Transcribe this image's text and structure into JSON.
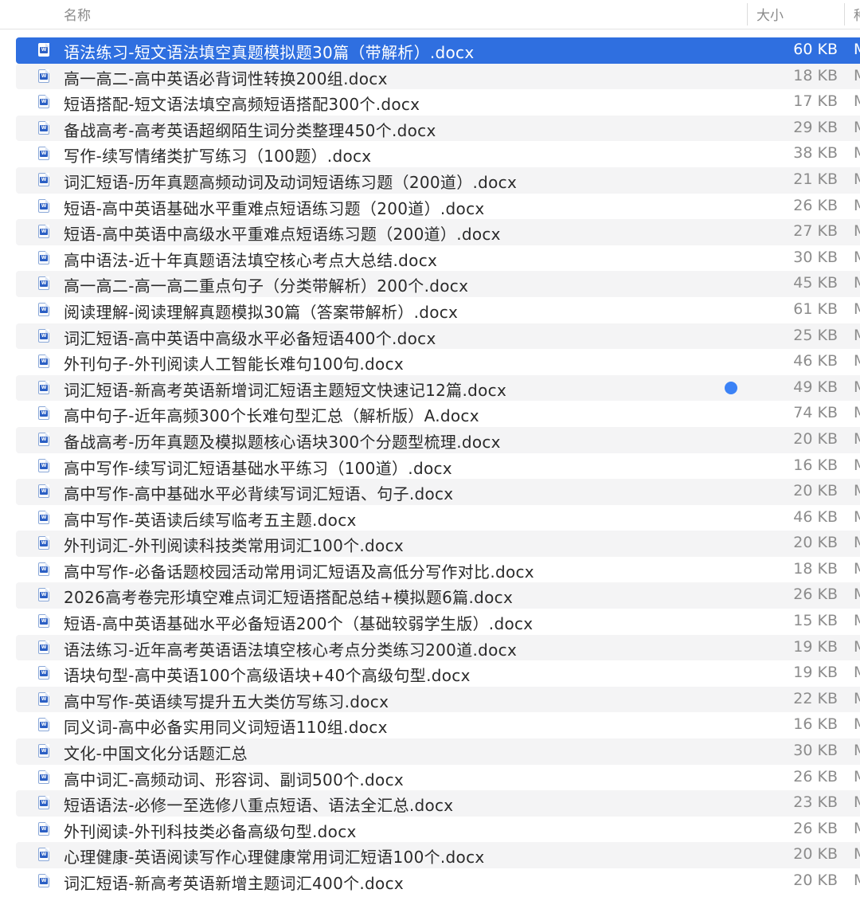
{
  "header": {
    "name_label": "名称",
    "size_label": "大小",
    "kind_label": "种"
  },
  "colors": {
    "selection": "#2f6fe0",
    "tag_dot": "#3b82f6",
    "stripe": "#f4f4f5"
  },
  "files": [
    {
      "name": "语法练习-短文语法填空真题模拟题30篇（带解析）.docx",
      "size": "60 KB",
      "kind": "M",
      "selected": true
    },
    {
      "name": "高一高二-高中英语必背词性转换200组.docx",
      "size": "18 KB",
      "kind": "M"
    },
    {
      "name": "短语搭配-短文语法填空高频短语搭配300个.docx",
      "size": "17 KB",
      "kind": "M"
    },
    {
      "name": "备战高考-高考英语超纲陌生词分类整理450个.docx",
      "size": "29 KB",
      "kind": "M"
    },
    {
      "name": "写作-续写情绪类扩写练习（100题）.docx",
      "size": "38 KB",
      "kind": "M"
    },
    {
      "name": "词汇短语-历年真题高频动词及动词短语练习题（200道）.docx",
      "size": "21 KB",
      "kind": "M"
    },
    {
      "name": "短语-高中英语基础水平重难点短语练习题（200道）.docx",
      "size": "26 KB",
      "kind": "M"
    },
    {
      "name": "短语-高中英语中高级水平重难点短语练习题（200道）.docx",
      "size": "27 KB",
      "kind": "M"
    },
    {
      "name": "高中语法-近十年真题语法填空核心考点大总结.docx",
      "size": "30 KB",
      "kind": "M"
    },
    {
      "name": "高一高二-高一高二重点句子（分类带解析）200个.docx",
      "size": "45 KB",
      "kind": "M"
    },
    {
      "name": "阅读理解-阅读理解真题模拟30篇（答案带解析）.docx",
      "size": "61 KB",
      "kind": "M"
    },
    {
      "name": "词汇短语-高中英语中高级水平必备短语400个.docx",
      "size": "25 KB",
      "kind": "M"
    },
    {
      "name": "外刊句子-外刊阅读人工智能长难句100句.docx",
      "size": "46 KB",
      "kind": "M"
    },
    {
      "name": "词汇短语-新高考英语新增词汇短语主题短文快速记12篇.docx",
      "size": "49 KB",
      "kind": "M",
      "tag": true
    },
    {
      "name": "高中句子-近年高频300个长难句型汇总（解析版）A.docx",
      "size": "74 KB",
      "kind": "M"
    },
    {
      "name": "备战高考-历年真题及模拟题核心语块300个分题型梳理.docx",
      "size": "20 KB",
      "kind": "M"
    },
    {
      "name": "高中写作-续写词汇短语基础水平练习（100道）.docx",
      "size": "16 KB",
      "kind": "M"
    },
    {
      "name": "高中写作-高中基础水平必背续写词汇短语、句子.docx",
      "size": "20 KB",
      "kind": "M"
    },
    {
      "name": "高中写作-英语读后续写临考五主题.docx",
      "size": "46 KB",
      "kind": "M"
    },
    {
      "name": "外刊词汇-外刊阅读科技类常用词汇100个.docx",
      "size": "20 KB",
      "kind": "M"
    },
    {
      "name": "高中写作-必备话题校园活动常用词汇短语及高低分写作对比.docx",
      "size": "18 KB",
      "kind": "M"
    },
    {
      "name": "2026高考卷完形填空难点词汇短语搭配总结+模拟题6篇.docx",
      "size": "26 KB",
      "kind": "M"
    },
    {
      "name": "短语-高中英语基础水平必备短语200个（基础较弱学生版）.docx",
      "size": "15 KB",
      "kind": "M"
    },
    {
      "name": "语法练习-近年高考英语语法填空核心考点分类练习200道.docx",
      "size": "19 KB",
      "kind": "M"
    },
    {
      "name": "语块句型-高中英语100个高级语块+40个高级句型.docx",
      "size": "19 KB",
      "kind": "M"
    },
    {
      "name": "高中写作-英语续写提升五大类仿写练习.docx",
      "size": "22 KB",
      "kind": "M"
    },
    {
      "name": "同义词-高中必备实用同义词短语110组.docx",
      "size": "16 KB",
      "kind": "M"
    },
    {
      "name": "文化-中国文化分话题汇总",
      "size": "30 KB",
      "kind": "M"
    },
    {
      "name": "高中词汇-高频动词、形容词、副词500个.docx",
      "size": "26 KB",
      "kind": "M"
    },
    {
      "name": "短语语法-必修一至选修八重点短语、语法全汇总.docx",
      "size": "23 KB",
      "kind": "M"
    },
    {
      "name": "外刊阅读-外刊科技类必备高级句型.docx",
      "size": "26 KB",
      "kind": "M"
    },
    {
      "name": "心理健康-英语阅读写作心理健康常用词汇短语100个.docx",
      "size": "20 KB",
      "kind": "M"
    },
    {
      "name": "词汇短语-新高考英语新增主题词汇400个.docx",
      "size": "20 KB",
      "kind": "M"
    }
  ]
}
